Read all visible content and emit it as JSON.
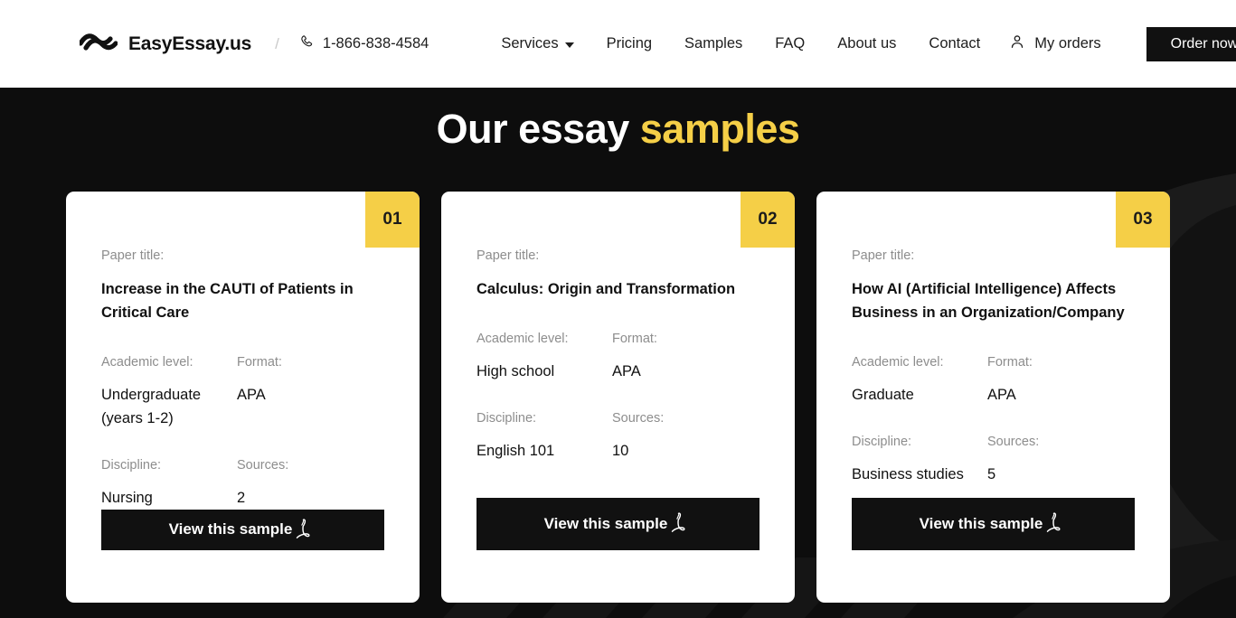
{
  "header": {
    "brand_name": "EasyEssay.us",
    "logo_icon": "wave-logo-icon",
    "divider": "/",
    "phone_icon": "phone-icon",
    "phone": "1-866-838-4584",
    "nav": [
      {
        "label": "Services",
        "has_dropdown": true
      },
      {
        "label": "Pricing",
        "has_dropdown": false
      },
      {
        "label": "Samples",
        "has_dropdown": false
      },
      {
        "label": "FAQ",
        "has_dropdown": false
      },
      {
        "label": "About us",
        "has_dropdown": false
      },
      {
        "label": "Contact",
        "has_dropdown": false
      }
    ],
    "my_orders_icon": "user-icon",
    "my_orders": "My orders",
    "order_now": "Order now"
  },
  "hero": {
    "title_plain": "Our essay ",
    "title_accent": "samples"
  },
  "labels": {
    "paper_title": "Paper title:",
    "academic_level": "Academic level:",
    "format": "Format:",
    "discipline": "Discipline:",
    "sources": "Sources:"
  },
  "button": {
    "view_sample": "View this sample",
    "pdf_icon": "adobe-pdf-icon"
  },
  "cards": [
    {
      "number": "01",
      "paper_title": "Increase in the CAUTI of Patients in Critical Care",
      "academic_level": "Undergraduate (years 1-2)",
      "format": "APA",
      "discipline": "Nursing",
      "sources": "2"
    },
    {
      "number": "02",
      "paper_title": "Calculus: Origin and Transformation",
      "academic_level": "High school",
      "format": "APA",
      "discipline": "English 101",
      "sources": "10"
    },
    {
      "number": "03",
      "paper_title": "How AI (Artificial Intelligence) Affects Business in an Organization/Company",
      "academic_level": "Graduate",
      "format": "APA",
      "discipline": "Business studies",
      "sources": "5"
    }
  ],
  "colors": {
    "accent_yellow": "#f5cf47",
    "dark": "#0d0d0d",
    "white": "#ffffff"
  }
}
